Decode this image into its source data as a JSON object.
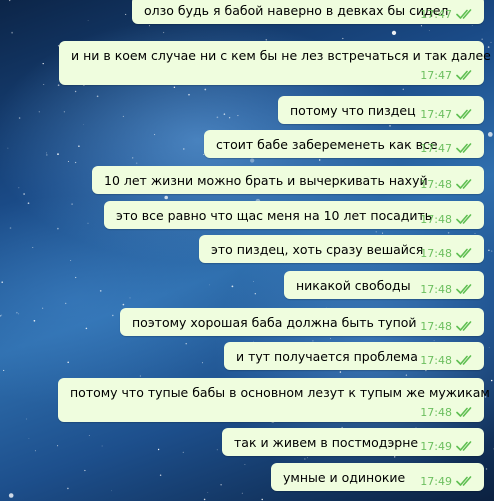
{
  "messages": [
    {
      "text": "олзо будь я бабой наверно в девках бы сидел",
      "time": "17:47",
      "status": "read"
    },
    {
      "text": "и ни в коем случае ни с кем бы не лез встречаться и так далее",
      "time": "17:47",
      "status": "read"
    },
    {
      "text": "потому что пиздец",
      "time": "17:47",
      "status": "read"
    },
    {
      "text": "стоит бабе забеременеть как все",
      "time": "17:47",
      "status": "read"
    },
    {
      "text": "10 лет жизни можно брать и вычеркивать нахуй",
      "time": "17:48",
      "status": "read"
    },
    {
      "text": "это все равно что щас меня на 10 лет посадить",
      "time": "17:48",
      "status": "read"
    },
    {
      "text": "это пиздец, хоть сразу вешайся",
      "time": "17:48",
      "status": "read"
    },
    {
      "text": "никакой свободы",
      "time": "17:48",
      "status": "read"
    },
    {
      "text": "поэтому хорошая баба должна быть тупой",
      "time": "17:48",
      "status": "read"
    },
    {
      "text": "и тут получается проблема",
      "time": "17:48",
      "status": "read"
    },
    {
      "text": "потому что тупые бабы в основном лезут к тупым же мужикам",
      "time": "17:48",
      "status": "read"
    },
    {
      "text": "так и живем в постмодэрне",
      "time": "17:49",
      "status": "read"
    },
    {
      "text": "умные и одинокие",
      "time": "17:49",
      "status": "read"
    }
  ],
  "colors": {
    "bubble": "#effdde",
    "time": "#6cbf5f",
    "check": "#5fbf52"
  }
}
